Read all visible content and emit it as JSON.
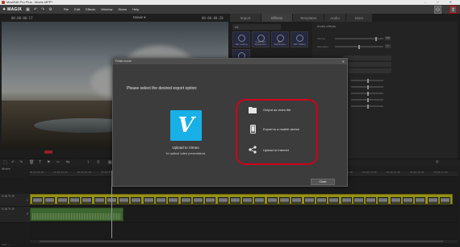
{
  "window": {
    "title": "MoviEdit Pro Plus - Movie MPP*",
    "controls": "–  □  ✕"
  },
  "app": {
    "logo": "✦ MAGIX",
    "menus": [
      "File",
      "Edit",
      "Effects",
      "Window",
      "Share",
      "Help"
    ],
    "project_title": "Movie ▾",
    "timecode_left": "00:00:00:17",
    "timecode_right": "00:00:00:20"
  },
  "toolbar_right": {
    "export_icon": "export-icon",
    "account_icon": "account-icon"
  },
  "tabs": [
    {
      "label": "Import",
      "active": false
    },
    {
      "label": "Effects",
      "active": true
    },
    {
      "label": "Templates",
      "active": false
    },
    {
      "label": "Audio",
      "active": false
    },
    {
      "label": "Store",
      "active": false
    }
  ],
  "effects_panel": {
    "filter_value": "All",
    "tiles": [
      {
        "label": "360° Editing"
      },
      {
        "label": "Voice 360° Stabilization"
      },
      {
        "label": "360° Stabilization"
      },
      {
        "label": "360° Editing"
      },
      {
        "label": ""
      }
    ]
  },
  "audio_effects": {
    "title": "Audio effects",
    "sliders": [
      {
        "label": "Volume",
        "value": "100",
        "fraction": 0.85
      },
      {
        "label": "Panorama",
        "value": "0",
        "fraction": 0.5
      }
    ],
    "buttons": [
      "",
      "",
      "",
      ""
    ],
    "eq_values": [
      "",
      "",
      "",
      "",
      ""
    ]
  },
  "timeline": {
    "track_name": "Movie",
    "ruler_ticks": [
      "00:00:00:00",
      "00:00:01:00",
      "00:00:02:00",
      "00:00:03:00",
      "00:00:04:00",
      "00:00:05:00",
      "00:00:06:00",
      "00:00:07:00",
      "00:00:08:00",
      "00:00:09:00",
      "00:00:10:00",
      "00:00:11:00",
      "00:00:12:00",
      "00:00:13:00",
      "00:00:14:00",
      "00:00:15:00",
      "00:00:16:00",
      "00:00:17:00"
    ],
    "track1_number": "1",
    "track2_number": "2",
    "track_controls": "S M ✎ ⟳",
    "status": "CPU: —"
  },
  "dialog": {
    "title": "Finish movie",
    "close": "✕",
    "prompt": "Please select the desired export option:",
    "vimeo_logo": "V",
    "vimeo_label": "Upload to Vimeo",
    "vimeo_sub": "for optimal online presentations",
    "options": [
      {
        "icon": "folder-icon",
        "label": "Output as video file"
      },
      {
        "icon": "phone-icon",
        "label": "Export to a mobile device"
      },
      {
        "icon": "share-icon",
        "label": "Upload to Internet"
      }
    ],
    "close_button": "Close"
  }
}
